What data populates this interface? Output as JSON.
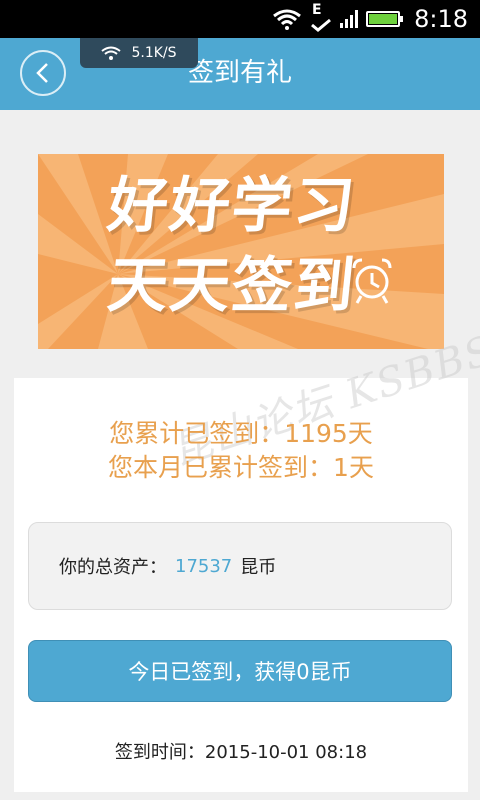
{
  "status_bar": {
    "time": "8:18",
    "network_type": "E"
  },
  "app_bar": {
    "title": "签到有礼",
    "speed": "5.1K/S"
  },
  "banner": {
    "line1": "好好学习",
    "line2": "天天签到"
  },
  "summary": {
    "cumulative": "您累计已签到：1195天",
    "monthly": "您本月已累计签到：1天"
  },
  "assets": {
    "label": "你的总资产：",
    "value": "17537",
    "unit": "昆币"
  },
  "action": {
    "button_label": "今日已签到，获得0昆币"
  },
  "sign_time": "签到时间：2015-10-01 08:18",
  "watermark": "昆山论坛 KSBBS",
  "colors": {
    "accent": "#4ea8d2",
    "banner": "#f3a258",
    "highlight_text": "#e8a04e"
  }
}
